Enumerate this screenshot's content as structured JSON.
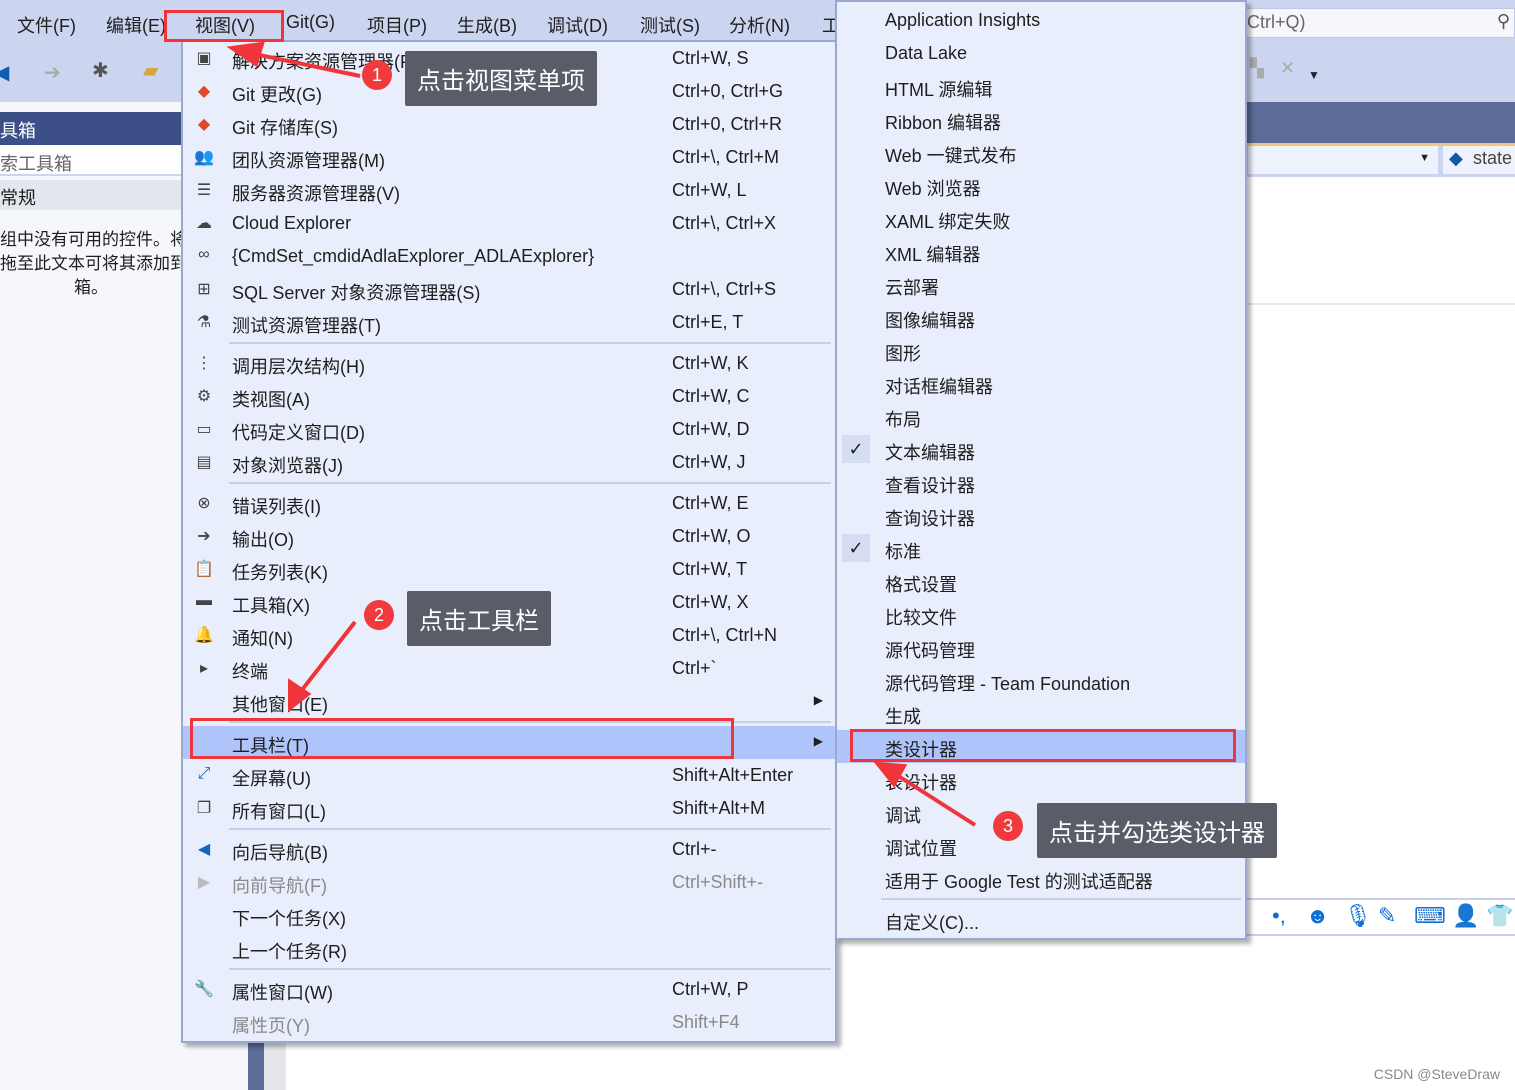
{
  "menubar": {
    "items": [
      "文件(F)",
      "编辑(E)",
      "视图(V)",
      "Git(G)",
      "项目(P)",
      "生成(B)",
      "调试(D)",
      "测试(S)",
      "分析(N)",
      "工"
    ]
  },
  "search": {
    "placeholder": "Ctrl+Q)"
  },
  "toolbox": {
    "title": "具箱",
    "search_placeholder": "索工具箱",
    "group": "常规",
    "empty_text": "组中没有可用的控件。将\n拖至此文本可将其添加到\n箱。"
  },
  "editor": {
    "combo_value": "state"
  },
  "view_menu": {
    "sections": [
      [
        {
          "icon": "solution-explorer-icon",
          "label": "解决方案资源管理器(P)",
          "shortcut": "Ctrl+W, S"
        },
        {
          "icon": "git-changes-icon",
          "label": "Git 更改(G)",
          "shortcut": "Ctrl+0, Ctrl+G"
        },
        {
          "icon": "git-repository-icon",
          "label": "Git 存储库(S)",
          "shortcut": "Ctrl+0, Ctrl+R"
        },
        {
          "icon": "team-explorer-icon",
          "label": "团队资源管理器(M)",
          "shortcut": "Ctrl+\\, Ctrl+M"
        },
        {
          "icon": "server-explorer-icon",
          "label": "服务器资源管理器(V)",
          "shortcut": "Ctrl+W, L"
        },
        {
          "icon": "cloud-icon",
          "label": "Cloud Explorer",
          "shortcut": "Ctrl+\\, Ctrl+X"
        },
        {
          "icon": "binoculars-icon",
          "label": "{CmdSet_cmdidAdlaExplorer_ADLAExplorer}",
          "shortcut": ""
        },
        {
          "icon": "sql-server-icon",
          "label": "SQL Server 对象资源管理器(S)",
          "shortcut": "Ctrl+\\, Ctrl+S"
        },
        {
          "icon": "test-explorer-icon",
          "label": "测试资源管理器(T)",
          "shortcut": "Ctrl+E, T"
        }
      ],
      [
        {
          "icon": "call-hierarchy-icon",
          "label": "调用层次结构(H)",
          "shortcut": "Ctrl+W, K"
        },
        {
          "icon": "class-view-icon",
          "label": "类视图(A)",
          "shortcut": "Ctrl+W, C"
        },
        {
          "icon": "code-definition-icon",
          "label": "代码定义窗口(D)",
          "shortcut": "Ctrl+W, D"
        },
        {
          "icon": "object-browser-icon",
          "label": "对象浏览器(J)",
          "shortcut": "Ctrl+W, J"
        }
      ],
      [
        {
          "icon": "error-list-icon",
          "label": "错误列表(I)",
          "shortcut": "Ctrl+W, E"
        },
        {
          "icon": "output-icon",
          "label": "输出(O)",
          "shortcut": "Ctrl+W, O"
        },
        {
          "icon": "task-list-icon",
          "label": "任务列表(K)",
          "shortcut": "Ctrl+W, T"
        },
        {
          "icon": "toolbox-icon",
          "label": "工具箱(X)",
          "shortcut": "Ctrl+W, X"
        },
        {
          "icon": "bell-icon",
          "label": "通知(N)",
          "shortcut": "Ctrl+\\, Ctrl+N"
        },
        {
          "icon": "terminal-icon",
          "label": "终端",
          "shortcut": "Ctrl+`"
        },
        {
          "icon": "",
          "label": "其他窗口(E)",
          "shortcut": "",
          "submenu": true
        }
      ],
      [
        {
          "icon": "",
          "label": "工具栏(T)",
          "shortcut": "",
          "submenu": true,
          "highlighted": true
        },
        {
          "icon": "fullscreen-icon",
          "label": "全屏幕(U)",
          "shortcut": "Shift+Alt+Enter"
        },
        {
          "icon": "all-windows-icon",
          "label": "所有窗口(L)",
          "shortcut": "Shift+Alt+M"
        }
      ],
      [
        {
          "icon": "navigate-back-icon",
          "label": "向后导航(B)",
          "shortcut": "Ctrl+-"
        },
        {
          "icon": "navigate-forward-icon",
          "label": "向前导航(F)",
          "shortcut": "Ctrl+Shift+-",
          "disabled": true
        },
        {
          "icon": "",
          "label": "下一个任务(X)",
          "shortcut": ""
        },
        {
          "icon": "",
          "label": "上一个任务(R)",
          "shortcut": ""
        }
      ],
      [
        {
          "icon": "wrench-icon",
          "label": "属性窗口(W)",
          "shortcut": "Ctrl+W, P"
        },
        {
          "icon": "",
          "label": "属性页(Y)",
          "shortcut": "Shift+F4",
          "disabled": true
        }
      ]
    ]
  },
  "toolbars_submenu": {
    "sections": [
      [
        {
          "label": "Application Insights"
        },
        {
          "label": "Data Lake"
        },
        {
          "label": "HTML 源编辑"
        },
        {
          "label": "Ribbon 编辑器"
        },
        {
          "label": "Web 一键式发布"
        },
        {
          "label": "Web 浏览器"
        },
        {
          "label": "XAML 绑定失败"
        },
        {
          "label": "XML 编辑器"
        },
        {
          "label": "云部署"
        },
        {
          "label": "图像编辑器"
        },
        {
          "label": "图形"
        },
        {
          "label": "对话框编辑器"
        },
        {
          "label": "布局"
        },
        {
          "label": "文本编辑器",
          "checked": true
        },
        {
          "label": "查看设计器"
        },
        {
          "label": "查询设计器"
        },
        {
          "label": "标准",
          "checked": true
        },
        {
          "label": "格式设置"
        },
        {
          "label": "比较文件"
        },
        {
          "label": "源代码管理"
        },
        {
          "label": "源代码管理 - Team Foundation"
        },
        {
          "label": "生成"
        },
        {
          "label": "类设计器",
          "highlighted": true
        },
        {
          "label": "表设计器"
        },
        {
          "label": "调试"
        },
        {
          "label": "调试位置"
        },
        {
          "label": "适用于 Google Test 的测试适配器"
        }
      ],
      [
        {
          "label": "自定义(C)..."
        }
      ]
    ]
  },
  "annotations": [
    {
      "number": "1",
      "text": "点击视图菜单项"
    },
    {
      "number": "2",
      "text": "点击工具栏"
    },
    {
      "number": "3",
      "text": "点击并勾选类设计器"
    }
  ],
  "watermark": "CSDN @SteveDraw",
  "colors": {
    "accent": "#0e6fd6",
    "highlight": "#aec4fa",
    "annotation_red": "#f13a3e",
    "menu_bg": "#e9eefc"
  }
}
